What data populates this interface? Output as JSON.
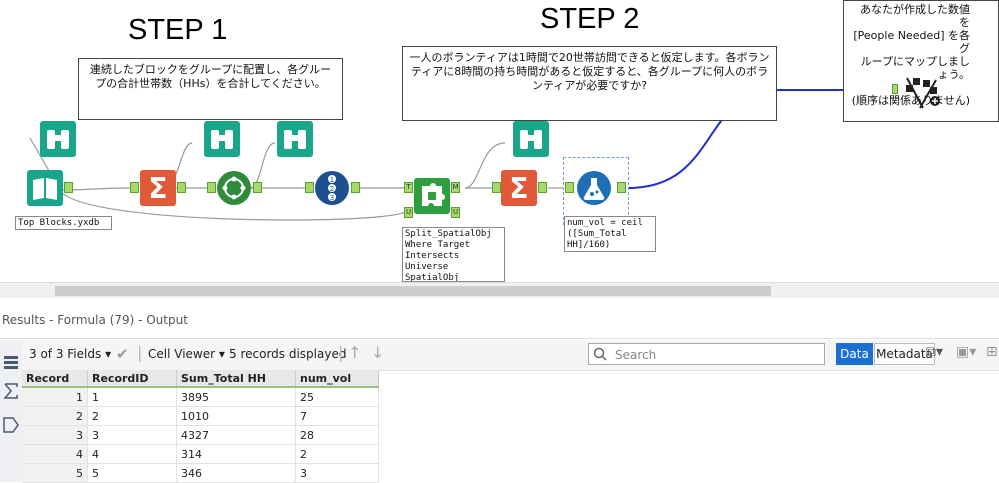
{
  "canvas": {
    "step1": "STEP 1",
    "step2": "STEP 2",
    "comment1": "連続したブロックをグループに配置し、各グループの合計世帯数（HHs）を合計してください。",
    "comment2": "一人のボランティアは1時間で20世帯訪問できると仮定します。各ボランティアに8時間の持ち時間があると仮定すると、各グループに何人のボランティアが必要ですか?",
    "comment3": "あなたが作成した数値を\n[People Needed] を各グ\nループにマップしましょう。\n\n(順序は関係ありません)",
    "input_label": "Top Blocks.yxdb",
    "spatial_label": "Split_SpatialObj\nWhere Target\nIntersects\nUniverse\nSpatialObj",
    "formula_label": "num_vol = ceil\n([Sum_Total\nHH]/160)",
    "anchor_T": "T",
    "anchor_U": "U",
    "anchor_M": "M",
    "anchor_U2": "U",
    "colors": {
      "browse": "#1aa68a",
      "summarize": "#e05a3a",
      "make_group": "#2e8b3a",
      "record_id": "#1d4f91",
      "spatial": "#2e9e3e",
      "formula": "#1d6fb8",
      "connection_blue": "#1f2fd0"
    }
  },
  "results": {
    "title": "Results - Formula (79) - Output",
    "fields": "3 of 3 Fields",
    "cell_viewer": "Cell Viewer",
    "records": "5 records displayed",
    "search_placeholder": "Search",
    "data_btn": "Data",
    "metadata_btn": "Metadata",
    "columns": [
      "Record",
      "RecordID",
      "Sum_Total HH",
      "num_vol"
    ],
    "rows": [
      [
        "1",
        "1",
        "3895",
        "25"
      ],
      [
        "2",
        "2",
        "1010",
        "7"
      ],
      [
        "3",
        "3",
        "4327",
        "28"
      ],
      [
        "4",
        "4",
        "314",
        "2"
      ],
      [
        "5",
        "5",
        "346",
        "3"
      ]
    ]
  }
}
